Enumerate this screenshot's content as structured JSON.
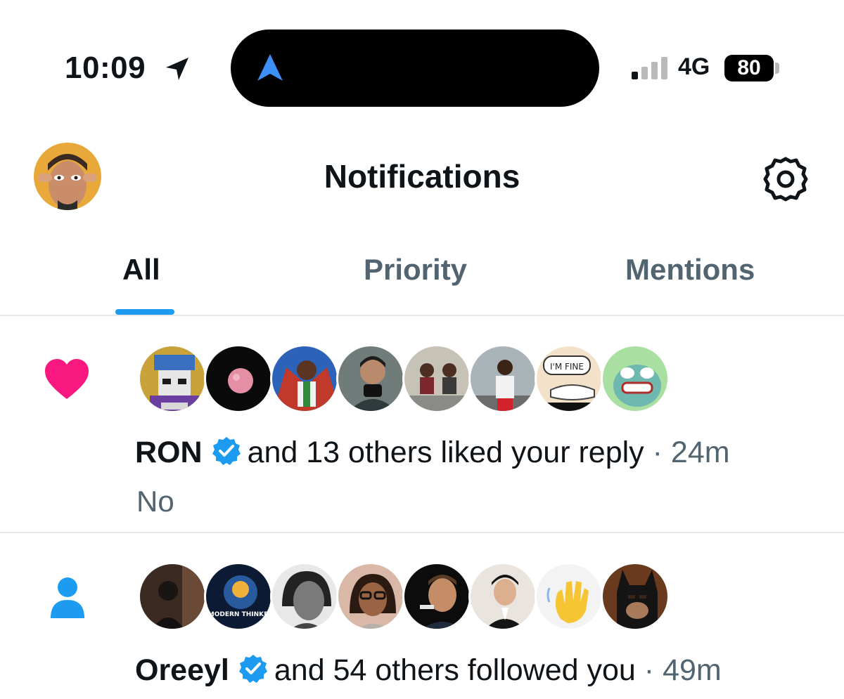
{
  "status_bar": {
    "time": "10:09",
    "network": "4G",
    "battery": "80",
    "icons": [
      "location-arrow-icon",
      "navigation-arrow-icon",
      "signal-bars-icon"
    ]
  },
  "header": {
    "title": "Notifications",
    "settings_icon": "gear-icon"
  },
  "tabs": [
    {
      "label": "All",
      "active": true
    },
    {
      "label": "Priority",
      "active": false
    },
    {
      "label": "Mentions",
      "active": false
    }
  ],
  "colors": {
    "accent": "#1d9bf0",
    "like": "#f91880",
    "text": "#0f1419",
    "muted": "#536471"
  },
  "notifications": [
    {
      "type": "like",
      "icon": "heart-icon",
      "actor": "RON",
      "verified": true,
      "action": "and 13 others liked your reply",
      "separator": "·",
      "time": "24m",
      "snippet": "No",
      "avatar_text": [
        "I'M FINE"
      ]
    },
    {
      "type": "follow",
      "icon": "person-icon",
      "actor": "Oreeyl",
      "verified": true,
      "action": "and 54 others followed you",
      "separator": "·",
      "time": "49m",
      "avatar_text": [
        "MODERN THINKER"
      ]
    }
  ]
}
